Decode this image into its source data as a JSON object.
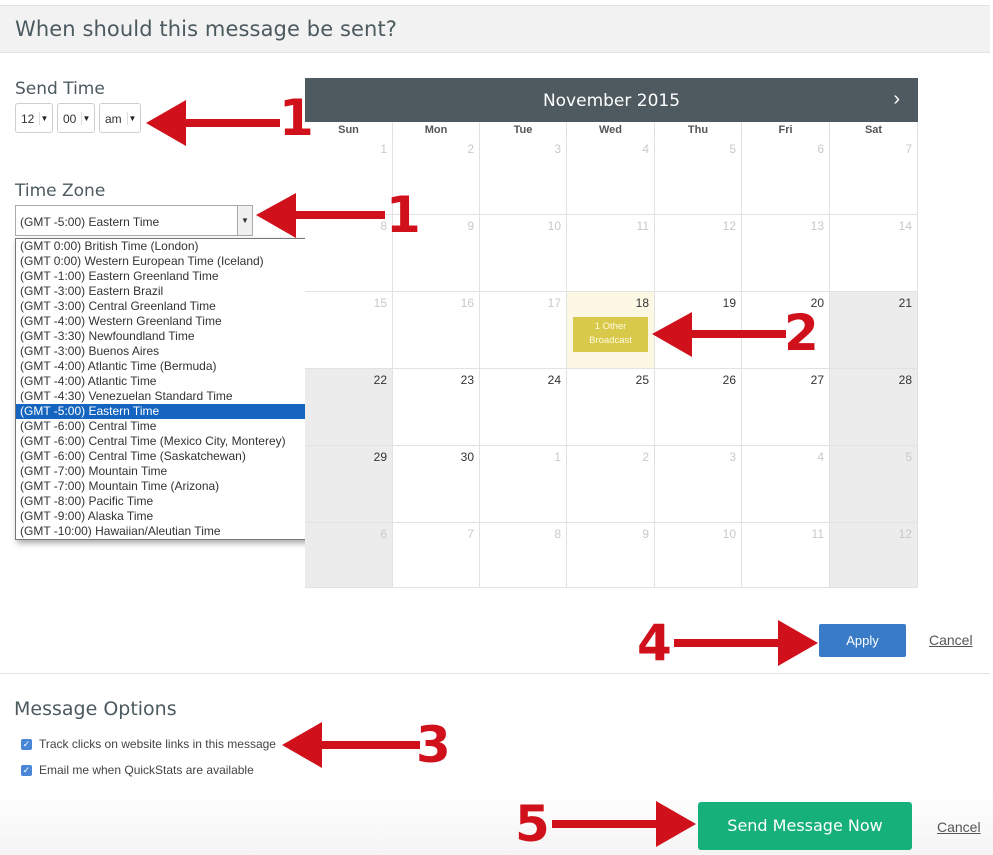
{
  "header": {
    "title": "When should this message be sent?"
  },
  "send_time": {
    "label": "Send Time",
    "hour": "12",
    "minute": "00",
    "ampm": "am"
  },
  "time_zone": {
    "label": "Time Zone",
    "selected": "(GMT -5:00) Eastern Time",
    "options": [
      "(GMT 0:00) British Time (London)",
      "(GMT 0:00) Western European Time (Iceland)",
      "(GMT -1:00) Eastern Greenland Time",
      "(GMT -3:00) Eastern Brazil",
      "(GMT -3:00) Central Greenland Time",
      "(GMT -4:00) Western Greenland Time",
      "(GMT -3:30) Newfoundland Time",
      "(GMT -3:00) Buenos Aires",
      "(GMT -4:00) Atlantic Time (Bermuda)",
      "(GMT -4:00) Atlantic Time",
      "(GMT -4:30) Venezuelan Standard Time",
      "(GMT -5:00) Eastern Time",
      "(GMT -6:00) Central Time",
      "(GMT -6:00) Central Time (Mexico City, Monterey)",
      "(GMT -6:00) Central Time (Saskatchewan)",
      "(GMT -7:00) Mountain Time",
      "(GMT -7:00) Mountain Time (Arizona)",
      "(GMT -8:00) Pacific Time",
      "(GMT -9:00) Alaska Time",
      "(GMT -10:00) Hawaiian/Aleutian Time"
    ],
    "selected_index": 11
  },
  "calendar": {
    "month_title": "November 2015",
    "next_icon": "chevron-right-icon",
    "days_of_week": [
      "Sun",
      "Mon",
      "Tue",
      "Wed",
      "Thu",
      "Fri",
      "Sat"
    ],
    "weeks": [
      [
        {
          "d": "1",
          "faded": true,
          "dis": false
        },
        {
          "d": "2",
          "faded": true,
          "dis": false
        },
        {
          "d": "3",
          "faded": true,
          "dis": false
        },
        {
          "d": "4",
          "faded": true,
          "dis": false
        },
        {
          "d": "5",
          "faded": true,
          "dis": false
        },
        {
          "d": "6",
          "faded": true,
          "dis": false
        },
        {
          "d": "7",
          "faded": true,
          "dis": false
        }
      ],
      [
        {
          "d": "8",
          "faded": true,
          "dis": false
        },
        {
          "d": "9",
          "faded": true,
          "dis": false
        },
        {
          "d": "10",
          "faded": true,
          "dis": false
        },
        {
          "d": "11",
          "faded": true,
          "dis": false
        },
        {
          "d": "12",
          "faded": true,
          "dis": false
        },
        {
          "d": "13",
          "faded": true,
          "dis": false
        },
        {
          "d": "14",
          "faded": true,
          "dis": false
        }
      ],
      [
        {
          "d": "15",
          "faded": true,
          "dis": false
        },
        {
          "d": "16",
          "faded": true,
          "dis": false
        },
        {
          "d": "17",
          "faded": true,
          "dis": false
        },
        {
          "d": "18",
          "faded": false,
          "dis": false,
          "today": true,
          "event": "1 Other Broadcast"
        },
        {
          "d": "19",
          "faded": false,
          "dis": false
        },
        {
          "d": "20",
          "faded": false,
          "dis": false
        },
        {
          "d": "21",
          "faded": false,
          "dis": true
        }
      ],
      [
        {
          "d": "22",
          "faded": false,
          "dis": true
        },
        {
          "d": "23",
          "faded": false,
          "dis": false
        },
        {
          "d": "24",
          "faded": false,
          "dis": false
        },
        {
          "d": "25",
          "faded": false,
          "dis": false
        },
        {
          "d": "26",
          "faded": false,
          "dis": false
        },
        {
          "d": "27",
          "faded": false,
          "dis": false
        },
        {
          "d": "28",
          "faded": false,
          "dis": true
        }
      ],
      [
        {
          "d": "29",
          "faded": false,
          "dis": true
        },
        {
          "d": "30",
          "faded": false,
          "dis": false
        },
        {
          "d": "1",
          "faded": true,
          "dis": false
        },
        {
          "d": "2",
          "faded": true,
          "dis": false
        },
        {
          "d": "3",
          "faded": true,
          "dis": false
        },
        {
          "d": "4",
          "faded": true,
          "dis": false
        },
        {
          "d": "5",
          "faded": true,
          "dis": true
        }
      ],
      [
        {
          "d": "6",
          "faded": true,
          "dis": true
        },
        {
          "d": "7",
          "faded": true,
          "dis": false
        },
        {
          "d": "8",
          "faded": true,
          "dis": false
        },
        {
          "d": "9",
          "faded": true,
          "dis": false
        },
        {
          "d": "10",
          "faded": true,
          "dis": false
        },
        {
          "d": "11",
          "faded": true,
          "dis": false
        },
        {
          "d": "12",
          "faded": true,
          "dis": true
        }
      ]
    ]
  },
  "actions": {
    "apply_label": "Apply",
    "cancel_label": "Cancel"
  },
  "message_options": {
    "title": "Message Options",
    "track_clicks_label": "Track clicks on website links in this message",
    "quickstats_label": "Email me when QuickStats are available"
  },
  "footer": {
    "send_label": "Send Message Now",
    "cancel_label": "Cancel"
  },
  "annotations": {
    "n1": "1",
    "n2": "2",
    "n3": "3",
    "n4": "4",
    "n5": "5"
  },
  "colors": {
    "accent_blue": "#3a7bc8",
    "send_green": "#16b07a",
    "arrow_red": "#d0101a",
    "calendar_header": "#4e5a5f"
  }
}
